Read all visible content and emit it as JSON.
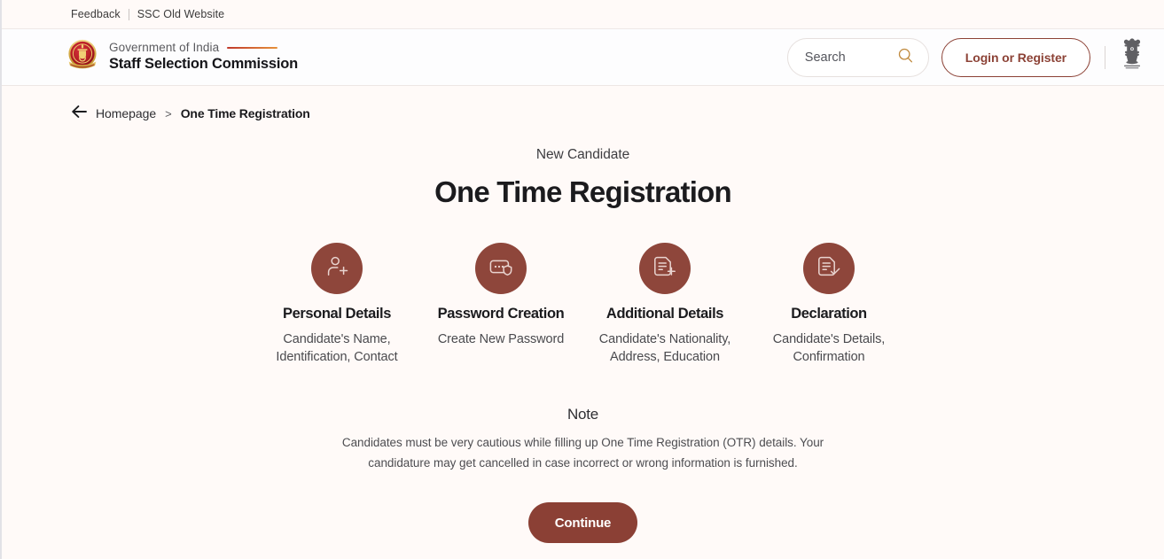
{
  "utility": {
    "links": [
      {
        "label": "Feedback"
      },
      {
        "label": "SSC Old Website"
      }
    ]
  },
  "header": {
    "gov_label": "Government of India",
    "org_title": "Staff Selection Commission",
    "search": {
      "value": "",
      "placeholder": "Search"
    },
    "login_label": "Login or Register",
    "emblem_alt": "Satyameva Jayate"
  },
  "breadcrumb": {
    "home_label": "Homepage",
    "separator": ">",
    "current_label": "One Time Registration"
  },
  "main": {
    "eyebrow": "New Candidate",
    "title": "One Time Registration",
    "steps": [
      {
        "icon": "user-add-icon",
        "title": "Personal Details",
        "desc": "Candidate's Name, Identification, Contact"
      },
      {
        "icon": "password-shield-icon",
        "title": "Password Creation",
        "desc": "Create New Password"
      },
      {
        "icon": "document-add-icon",
        "title": "Additional Details",
        "desc": "Candidate's Nationality, Address, Education"
      },
      {
        "icon": "document-check-icon",
        "title": "Declaration",
        "desc": "Candidate's Details, Confirmation"
      }
    ],
    "note": {
      "title": "Note",
      "body": "Candidates must be very cautious while filling up One Time Registration (OTR) details. Your candidature may get cancelled in case incorrect or wrong information is furnished."
    },
    "continue_label": "Continue"
  },
  "colors": {
    "page_bg": "#FFFAF8",
    "header_bg": "#FDFDFE",
    "brand_maroon": "#8C4236",
    "step_circle": "#8E463B",
    "continue_bg": "#8B4035",
    "rule_gradient_start": "#C0392B",
    "rule_gradient_end": "#E6923B"
  }
}
